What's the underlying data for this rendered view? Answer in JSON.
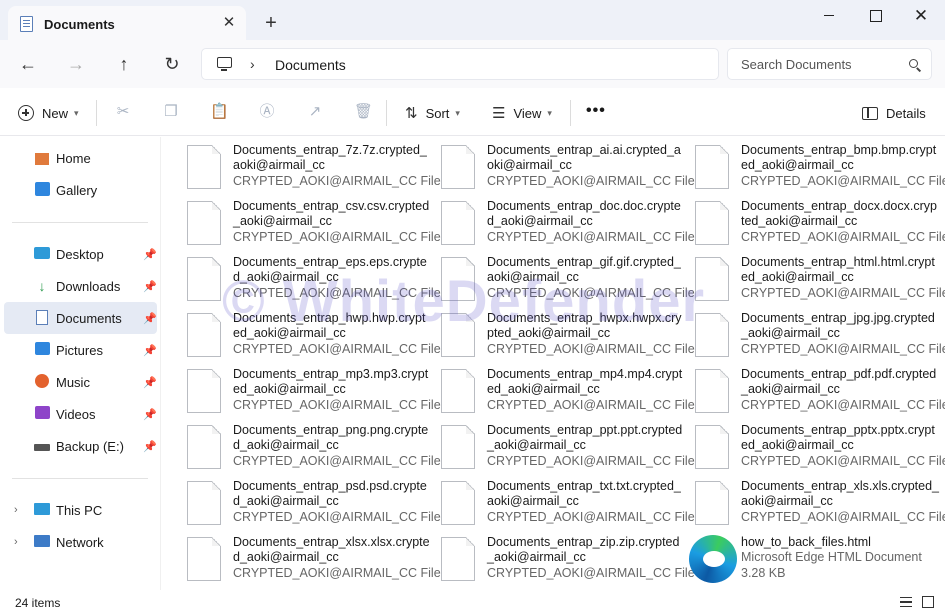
{
  "tab": {
    "title": "Documents",
    "close": "✕",
    "new_tab": "+"
  },
  "window_controls": {
    "close": "✕"
  },
  "nav": {
    "back": "←",
    "forward": "→",
    "up": "↑",
    "refresh": "↻"
  },
  "address": {
    "chevron": "›",
    "location": "Documents"
  },
  "search": {
    "placeholder": "Search Documents"
  },
  "toolbar": {
    "new_label": "New",
    "sort_label": "Sort",
    "view_label": "View",
    "more": "•••",
    "details_label": "Details",
    "sort_glyph": "⇅",
    "view_glyph": "☰"
  },
  "sidebar": {
    "items": [
      {
        "label": "Home"
      },
      {
        "label": "Gallery"
      },
      {
        "label": "Desktop"
      },
      {
        "label": "Downloads"
      },
      {
        "label": "Documents"
      },
      {
        "label": "Pictures"
      },
      {
        "label": "Music"
      },
      {
        "label": "Videos"
      },
      {
        "label": "Backup (E:)"
      },
      {
        "label": "This PC"
      },
      {
        "label": "Network"
      }
    ],
    "pin_glyph": "📌",
    "expander": "›"
  },
  "files": [
    {
      "name": "Documents_entrap_7z.7z.crypted_aoki@airmail_cc",
      "type": "CRYPTED_AOKI@AIRMAIL_CC File"
    },
    {
      "name": "Documents_entrap_ai.ai.crypted_aoki@airmail_cc",
      "type": "CRYPTED_AOKI@AIRMAIL_CC File"
    },
    {
      "name": "Documents_entrap_bmp.bmp.crypted_aoki@airmail_cc",
      "type": "CRYPTED_AOKI@AIRMAIL_CC File"
    },
    {
      "name": "Documents_entrap_csv.csv.crypted_aoki@airmail_cc",
      "type": "CRYPTED_AOKI@AIRMAIL_CC File"
    },
    {
      "name": "Documents_entrap_doc.doc.crypted_aoki@airmail_cc",
      "type": "CRYPTED_AOKI@AIRMAIL_CC File"
    },
    {
      "name": "Documents_entrap_docx.docx.crypted_aoki@airmail_cc",
      "type": "CRYPTED_AOKI@AIRMAIL_CC File"
    },
    {
      "name": "Documents_entrap_eps.eps.crypted_aoki@airmail_cc",
      "type": "CRYPTED_AOKI@AIRMAIL_CC File"
    },
    {
      "name": "Documents_entrap_gif.gif.crypted_aoki@airmail_cc",
      "type": "CRYPTED_AOKI@AIRMAIL_CC File"
    },
    {
      "name": "Documents_entrap_html.html.crypted_aoki@airmail_cc",
      "type": "CRYPTED_AOKI@AIRMAIL_CC File"
    },
    {
      "name": "Documents_entrap_hwp.hwp.crypted_aoki@airmail_cc",
      "type": "CRYPTED_AOKI@AIRMAIL_CC File"
    },
    {
      "name": "Documents_entrap_hwpx.hwpx.crypted_aoki@airmail_cc",
      "type": "CRYPTED_AOKI@AIRMAIL_CC File"
    },
    {
      "name": "Documents_entrap_jpg.jpg.crypted_aoki@airmail_cc",
      "type": "CRYPTED_AOKI@AIRMAIL_CC File"
    },
    {
      "name": "Documents_entrap_mp3.mp3.crypted_aoki@airmail_cc",
      "type": "CRYPTED_AOKI@AIRMAIL_CC File"
    },
    {
      "name": "Documents_entrap_mp4.mp4.crypted_aoki@airmail_cc",
      "type": "CRYPTED_AOKI@AIRMAIL_CC File"
    },
    {
      "name": "Documents_entrap_pdf.pdf.crypted_aoki@airmail_cc",
      "type": "CRYPTED_AOKI@AIRMAIL_CC File"
    },
    {
      "name": "Documents_entrap_png.png.crypted_aoki@airmail_cc",
      "type": "CRYPTED_AOKI@AIRMAIL_CC File"
    },
    {
      "name": "Documents_entrap_ppt.ppt.crypted_aoki@airmail_cc",
      "type": "CRYPTED_AOKI@AIRMAIL_CC File"
    },
    {
      "name": "Documents_entrap_pptx.pptx.crypted_aoki@airmail_cc",
      "type": "CRYPTED_AOKI@AIRMAIL_CC File"
    },
    {
      "name": "Documents_entrap_psd.psd.crypted_aoki@airmail_cc",
      "type": "CRYPTED_AOKI@AIRMAIL_CC File"
    },
    {
      "name": "Documents_entrap_txt.txt.crypted_aoki@airmail_cc",
      "type": "CRYPTED_AOKI@AIRMAIL_CC File"
    },
    {
      "name": "Documents_entrap_xls.xls.crypted_aoki@airmail_cc",
      "type": "CRYPTED_AOKI@AIRMAIL_CC File"
    },
    {
      "name": "Documents_entrap_xlsx.xlsx.crypted_aoki@airmail_cc",
      "type": "CRYPTED_AOKI@AIRMAIL_CC File"
    },
    {
      "name": "Documents_entrap_zip.zip.crypted_aoki@airmail_cc",
      "type": "CRYPTED_AOKI@AIRMAIL_CC File"
    },
    {
      "name": "how_to_back_files.html",
      "type": "Microsoft Edge HTML Document",
      "size": "3.28 KB"
    }
  ],
  "watermark": "© WhiteDefender",
  "status": {
    "item_count": "24 items"
  }
}
